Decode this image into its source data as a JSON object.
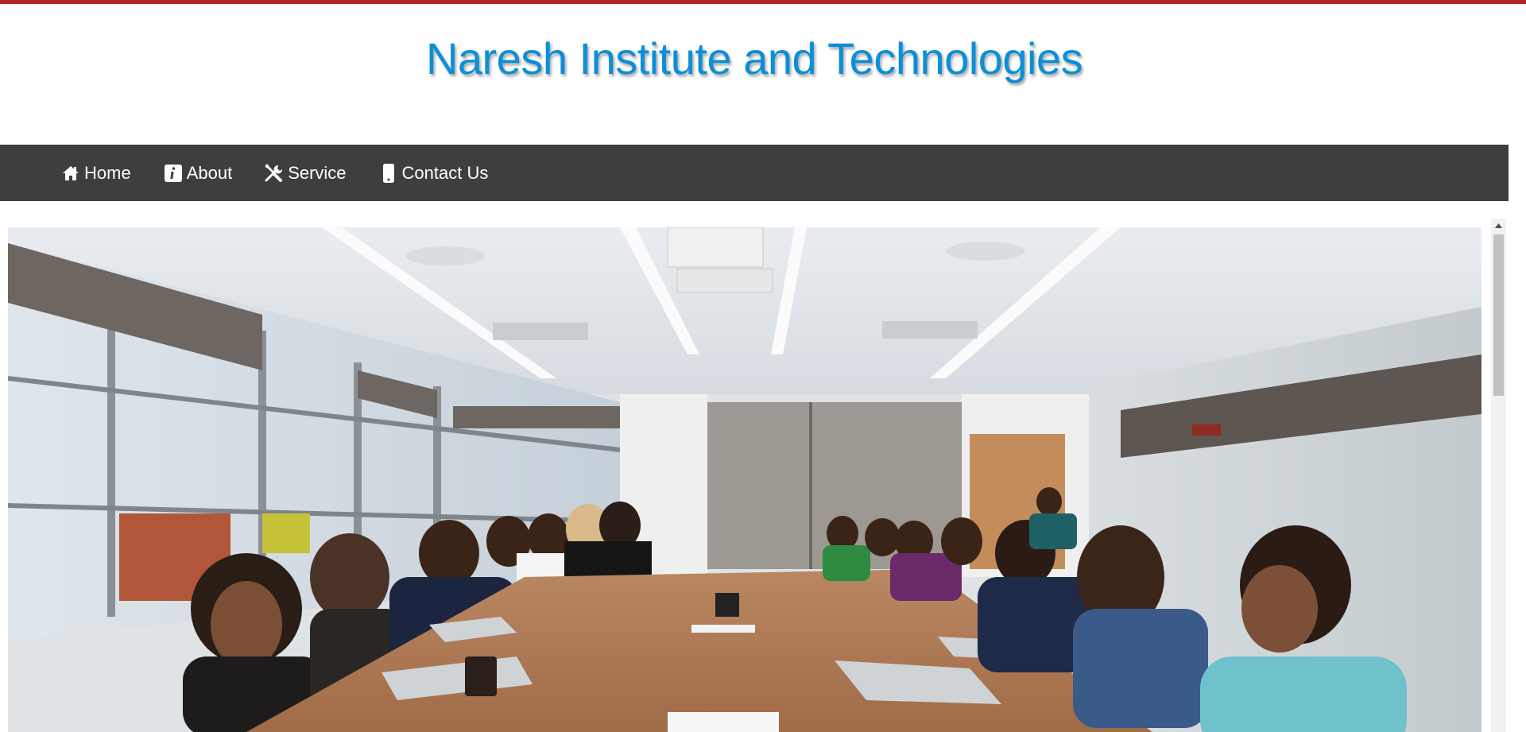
{
  "header": {
    "title": "Naresh Institute and Technologies"
  },
  "nav": {
    "items": [
      {
        "label": "Home",
        "icon": "home-icon"
      },
      {
        "label": "About",
        "icon": "info-icon"
      },
      {
        "label": "Service",
        "icon": "tools-icon"
      },
      {
        "label": "Contact Us",
        "icon": "phone-icon"
      }
    ]
  },
  "hero": {
    "image": "conference-room-meeting-photo"
  },
  "colors": {
    "top_bar": "#b3262a",
    "title": "#0a8fd8",
    "navbar": "#3f3e3d",
    "nav_text": "#ffffff"
  }
}
